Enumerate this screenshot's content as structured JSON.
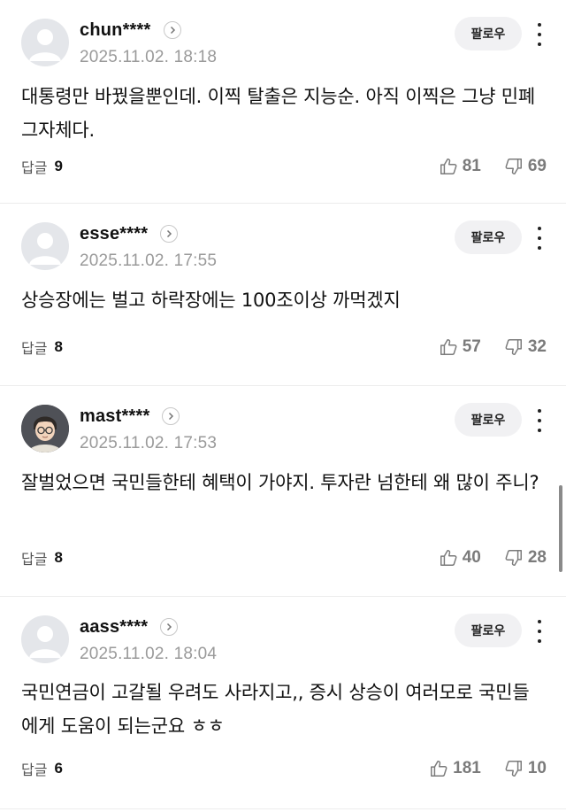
{
  "labels": {
    "follow": "팔로우",
    "reply": "답글"
  },
  "comments": [
    {
      "username": "chun****",
      "timestamp": "2025.11.02. 18:18",
      "text": "대통령만 바꿨을뿐인데. 이찍 탈출은 지능순. 아직 이찍은 그냥 민폐 그자체다.",
      "replies": "9",
      "likes": "81",
      "dislikes": "69",
      "avatar": "default-avatar-icon"
    },
    {
      "username": "esse****",
      "timestamp": "2025.11.02. 17:55",
      "text": "상승장에는 벌고 하락장에는 100조이상 까먹겠지",
      "replies": "8",
      "likes": "57",
      "dislikes": "32",
      "avatar": "default-avatar-icon"
    },
    {
      "username": "mast****",
      "timestamp": "2025.11.02. 17:53",
      "text": "잘벌었으면 국민들한테 혜택이 가야지. 투자란 넘한테 왜 많이 주니?",
      "replies": "8",
      "likes": "40",
      "dislikes": "28",
      "avatar": "character-avatar-icon"
    },
    {
      "username": "aass****",
      "timestamp": "2025.11.02. 18:04",
      "text": "국민연금이 고갈될 우려도 사라지고,, 증시 상승이 여러모로 국민들에게 도움이 되는군요 ㅎㅎ",
      "replies": "6",
      "likes": "181",
      "dislikes": "10",
      "avatar": "default-avatar-icon"
    }
  ],
  "colors": {
    "text": "#111111",
    "muted": "#9a9a9a",
    "reaction": "#7b7b7b",
    "button_bg": "#f1f1f3",
    "divider": "#ececec"
  }
}
